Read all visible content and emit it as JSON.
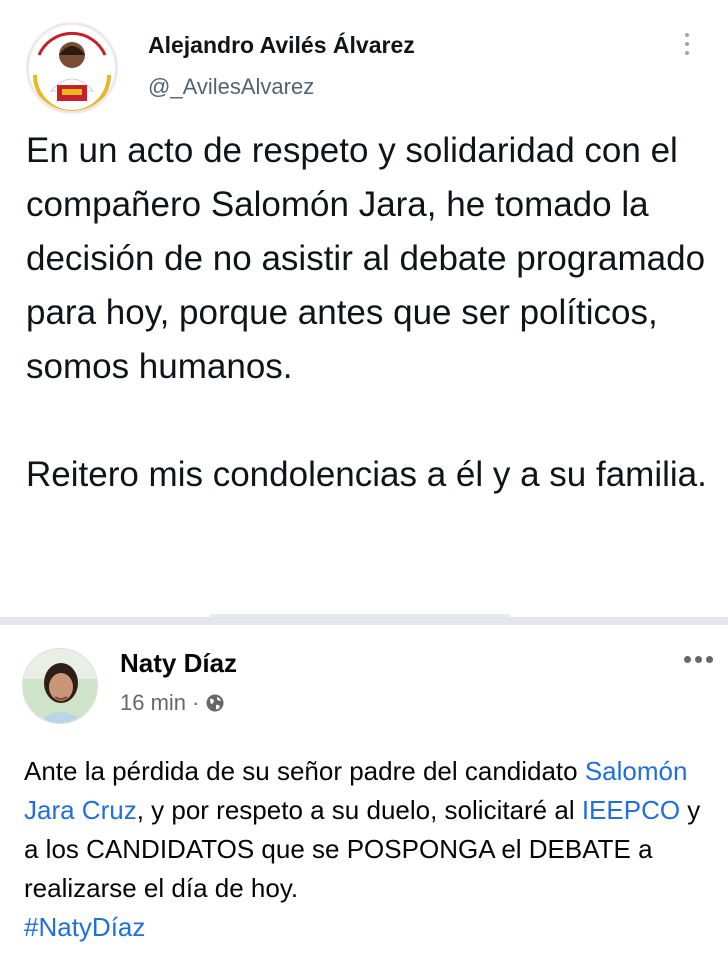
{
  "tweet": {
    "author_name": "Alejandro Avilés Álvarez",
    "handle": "@_AvilesAlvarez",
    "paragraph1": "En un acto de respeto y solidaridad con el compañero Salomón Jara, he tomado la decisión de no asistir al debate programado para hoy, porque antes que ser políticos, somos humanos.",
    "paragraph2": "Reitero mis condolencias a él y a su familia.",
    "more_icon": "vertical-dots-icon"
  },
  "post": {
    "author_name": "Naty Díaz",
    "time": "16 min",
    "separator": "·",
    "audience_icon": "globe-icon",
    "more_icon": "horizontal-dots-icon",
    "body": {
      "part1": "Ante la pérdida de su señor padre del candidato ",
      "mention1": "Salomón Jara Cruz",
      "part2": ", y por respeto a su duelo, solicitaré al ",
      "mention2": "IEEPCO",
      "part3": " y a los CANDIDATOS que se POSPONGA el DEBATE a realizarse el día de hoy.",
      "hashtag": "#NatyDíaz"
    }
  },
  "colors": {
    "link": "#216fdb",
    "secondary_text": "#536471",
    "divider": "#e4e6eb"
  }
}
